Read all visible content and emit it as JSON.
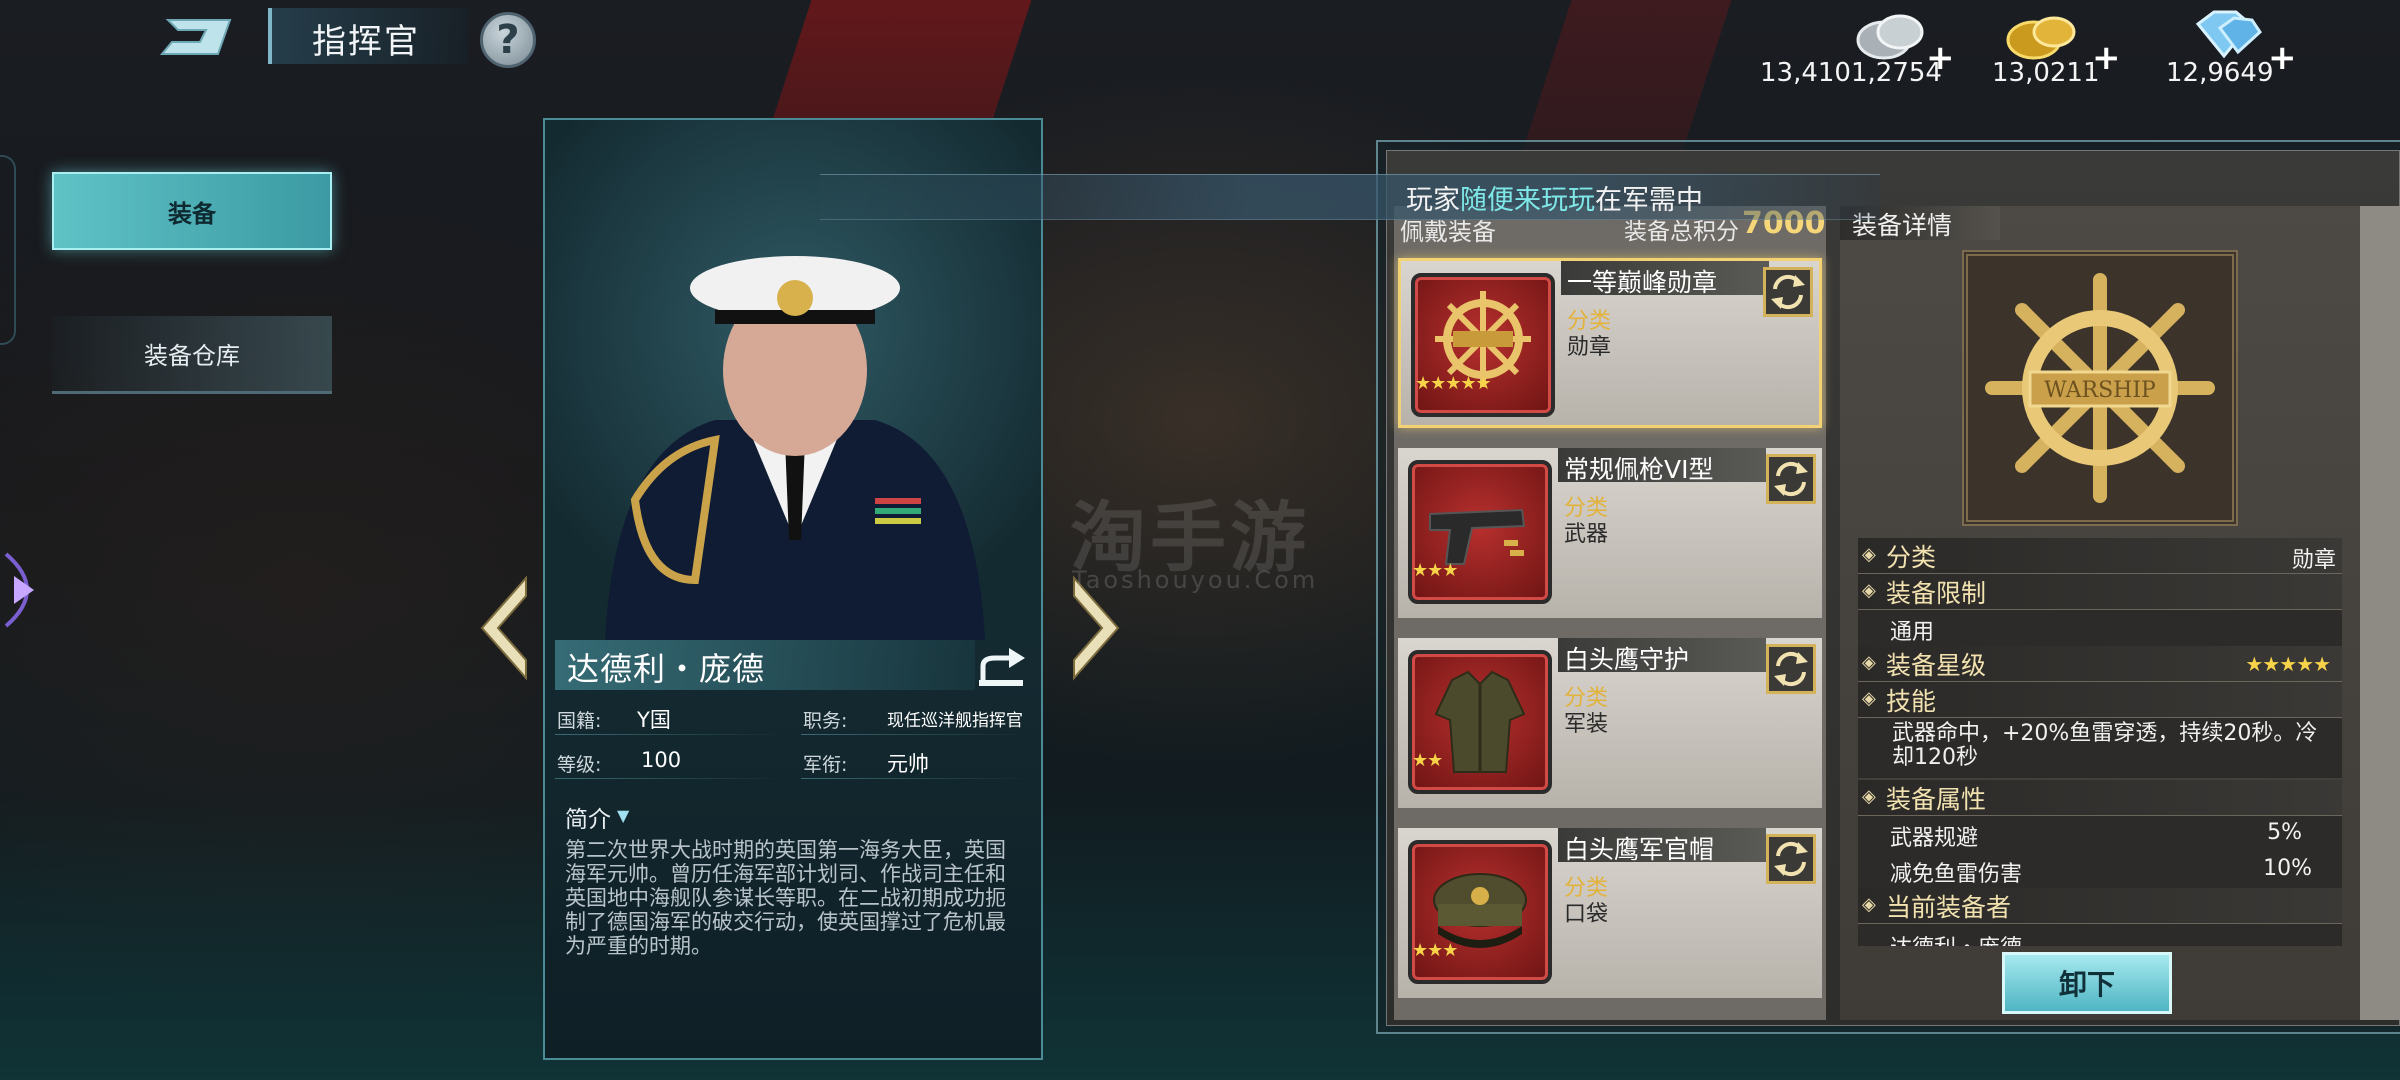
{
  "header": {
    "title": "指挥官",
    "help_label": "?"
  },
  "resources": [
    {
      "name": "silver",
      "value": "13,4101,2754",
      "icon": "silver-coins-icon"
    },
    {
      "name": "gold",
      "value": "13,0211",
      "icon": "gold-coins-icon"
    },
    {
      "name": "diamond",
      "value": "12,9649",
      "icon": "diamond-icon"
    }
  ],
  "resource_plus": "+",
  "sidebar": {
    "tabs": [
      {
        "label": "装备",
        "active": true
      },
      {
        "label": "装备仓库",
        "active": false
      }
    ]
  },
  "commander": {
    "name": "达德利・庞德",
    "info": [
      {
        "label": "国籍:",
        "value": "Y国"
      },
      {
        "label": "职务:",
        "value": "现任巡洋舰指挥官"
      },
      {
        "label": "等级:",
        "value": "100"
      },
      {
        "label": "军衔:",
        "value": "元帅"
      }
    ],
    "intro_label": "简介",
    "intro_text": "第二次世界大战时期的英国第一海务大臣，英国海军元帅。曾历任海军部计划司、作战司主任和英国地中海舰队参谋长等职。在二战初期成功扼制了德国海军的破交行动，使英国撑过了危机最为严重的时期。"
  },
  "notice": {
    "prefix": "玩家",
    "player": "随便来玩玩",
    "suffix": "在军需中"
  },
  "equipment": {
    "header_label": "佩戴装备",
    "score_label": "装备总积分",
    "score_value": "7000",
    "items": [
      {
        "name": "一等巅峰勋章",
        "cat_label": "分类",
        "category": "勋章",
        "stars": "★★★★★",
        "icon": "medal-icon",
        "selected": true
      },
      {
        "name": "常规佩枪VI型",
        "cat_label": "分类",
        "category": "武器",
        "stars": "★★★",
        "icon": "pistol-icon",
        "selected": false
      },
      {
        "name": "白头鹰守护",
        "cat_label": "分类",
        "category": "军装",
        "stars": "★★",
        "icon": "uniform-icon",
        "selected": false
      },
      {
        "name": "白头鹰军官帽",
        "cat_label": "分类",
        "category": "口袋",
        "stars": "★★★",
        "icon": "officer-cap-icon",
        "selected": false
      }
    ]
  },
  "details": {
    "title": "装备详情",
    "category_label": "分类",
    "category_value": "勋章",
    "restriction_label": "装备限制",
    "restriction_value": "通用",
    "star_label": "装备星级",
    "star_value": "★★★★★",
    "skill_label": "技能",
    "skill_text": "武器命中，+20%鱼雷穿透，持续20秒。冷却120秒",
    "attr_label": "装备属性",
    "attrs": [
      {
        "name": "武器规避",
        "value": "5%"
      },
      {
        "name": "减免鱼雷伤害",
        "value": "10%"
      }
    ],
    "owner_label": "当前装备者",
    "owner_value": "达德利・庞德",
    "unequip_label": "卸下"
  },
  "watermark": {
    "main": "淘手游",
    "sub": "Taoshouyou.Com"
  },
  "colors": {
    "accent_cyan": "#5fc3c6",
    "gold": "#f5d77a",
    "star": "#f7d34a",
    "item_red": "#b8302e"
  }
}
